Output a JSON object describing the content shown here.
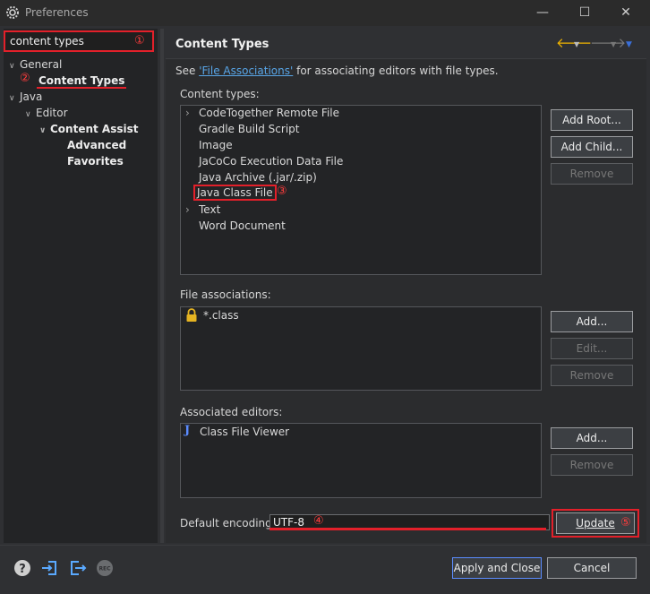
{
  "window": {
    "title": "Preferences",
    "controls": {
      "minimize": "—",
      "maximize": "☐",
      "close": "✕"
    }
  },
  "filter": {
    "value": "content types"
  },
  "tree": {
    "general": "General",
    "content_types": "Content Types",
    "java": "Java",
    "editor": "Editor",
    "content_assist": "Content Assist",
    "advanced": "Advanced",
    "favorites": "Favorites"
  },
  "page": {
    "title": "Content Types",
    "see_prefix": "See ",
    "see_link": "'File Associations'",
    "see_suffix": " for associating editors with file types."
  },
  "content_types": {
    "label": "Content types:",
    "items": [
      "CodeTogether Remote File",
      "Gradle Build Script",
      "Image",
      "JaCoCo Execution Data File",
      "Java Archive (.jar/.zip)",
      "Java Class File",
      "Text",
      "Word Document"
    ],
    "buttons": {
      "add_root": "Add Root...",
      "add_child": "Add Child...",
      "remove": "Remove"
    }
  },
  "file_associations": {
    "label": "File associations:",
    "items": [
      "*.class"
    ],
    "buttons": {
      "add": "Add...",
      "edit": "Edit...",
      "remove": "Remove"
    }
  },
  "associated_editors": {
    "label": "Associated editors:",
    "items": [
      "Class File Viewer"
    ],
    "buttons": {
      "add": "Add...",
      "remove": "Remove"
    }
  },
  "encoding": {
    "label": "Default encoding:",
    "value": "UTF-8",
    "update": "Update"
  },
  "footer": {
    "apply_close": "Apply and Close",
    "cancel": "Cancel",
    "rec": "REC"
  },
  "badges": {
    "b1": "①",
    "b2": "②",
    "b3": "③",
    "b4": "④",
    "b5": "⑤"
  },
  "colors": {
    "highlight": "#e3202a",
    "link": "#58a6e8",
    "nav_arrow": "#f0b400",
    "accent_blue": "#3a6fd8"
  }
}
